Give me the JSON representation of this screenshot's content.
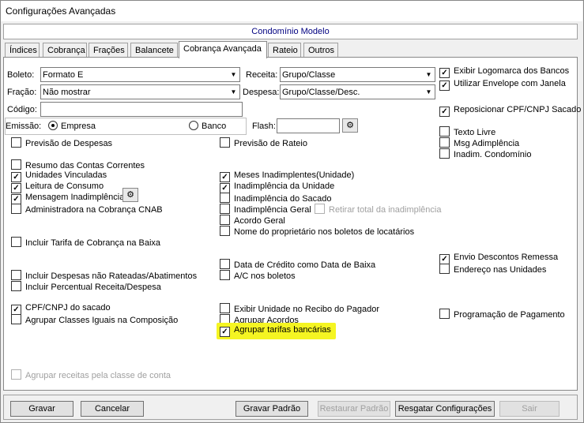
{
  "window": {
    "title": "Configurações Avançadas"
  },
  "header": {
    "title": "Condomínio Modelo"
  },
  "tabs": [
    "Índices",
    "Cobrança",
    "Frações",
    "Balancete",
    "Cobrança Avançada",
    "Rateio",
    "Outros"
  ],
  "form": {
    "boleto_label": "Boleto:",
    "boleto_value": "Formato E",
    "fracao_label": "Fração:",
    "fracao_value": "Não mostrar",
    "codigo_label": "Código:",
    "codigo_value": "",
    "emissao_label": "Emissão:",
    "emissao_empresa": "Empresa",
    "emissao_banco": "Banco",
    "receita_label": "Receita:",
    "receita_value": "Grupo/Classe",
    "despesa_label": "Despesa:",
    "despesa_value": "Grupo/Classe/Desc.",
    "flash_label": "Flash:",
    "flash_value": ""
  },
  "checks": {
    "exibir_logomarca": "Exibir Logomarca dos Bancos",
    "utilizar_envelope": "Utilizar Envelope com Janela",
    "reposicionar_cpf": "Reposicionar CPF/CNPJ Sacado",
    "texto_livre": "Texto Livre",
    "msg_adimplencia": "Msg Adimplência",
    "inadim_condominio": "Inadim. Condomínio",
    "previsao_despesas": "Previsão de Despesas",
    "previsao_rateio": "Previsão de Rateio",
    "resumo_contas": "Resumo das Contas Correntes",
    "unidades_vinculadas": "Unidades Vinculadas",
    "leitura_consumo": "Leitura de Consumo",
    "mensagem_inadimplencia": "Mensagem Inadimplência",
    "administradora_cnab": "Administradora na Cobrança CNAB",
    "meses_inadimplentes": "Meses Inadimplentes(Unidade)",
    "inadimplencia_unidade": "Inadimplência da Unidade",
    "inadimplencia_sacado": "Inadimplência do Sacado",
    "inadimplencia_geral": "Inadimplência Geral",
    "retirar_total": "Retirar total da inadimplência",
    "acordo_geral": "Acordo Geral",
    "nome_proprietario": "Nome do proprietário nos boletos de locatários",
    "incluir_tarifa": "Incluir Tarifa de Cobrança na Baixa",
    "data_credito": "Data de Crédito como Data de Baixa",
    "ac_boletos": "A/C nos boletos",
    "envio_descontos": "Envio Descontos Remessa",
    "endereco_unidades": "Endereço nas Unidades",
    "incluir_despesas": "Incluir Despesas não Rateadas/Abatimentos",
    "incluir_percentual": "Incluir Percentual Receita/Despesa",
    "cpf_cnpj_sacado": "CPF/CNPJ do sacado",
    "agrupar_classes": "Agrupar Classes Iguais na Composição",
    "exibir_unidade_recibo": "Exibir Unidade no Recibo do Pagador",
    "agrupar_acordos": "Agrupar Acordos",
    "agrupar_tarifas": "Agrupar tarifas bancárias",
    "programacao_pagamento": "Programação de Pagamento",
    "agrupar_receitas": "Agrupar receitas pela classe de conta"
  },
  "buttons": {
    "gravar": "Gravar",
    "cancelar": "Cancelar",
    "gravar_padrao": "Gravar Padrão",
    "restaurar_padrao": "Restaurar Padrão",
    "resgatar_config": "Resgatar Configurações",
    "sair": "Sair"
  },
  "colors": {
    "highlight": "#f5f522",
    "header_text": "#000080"
  }
}
